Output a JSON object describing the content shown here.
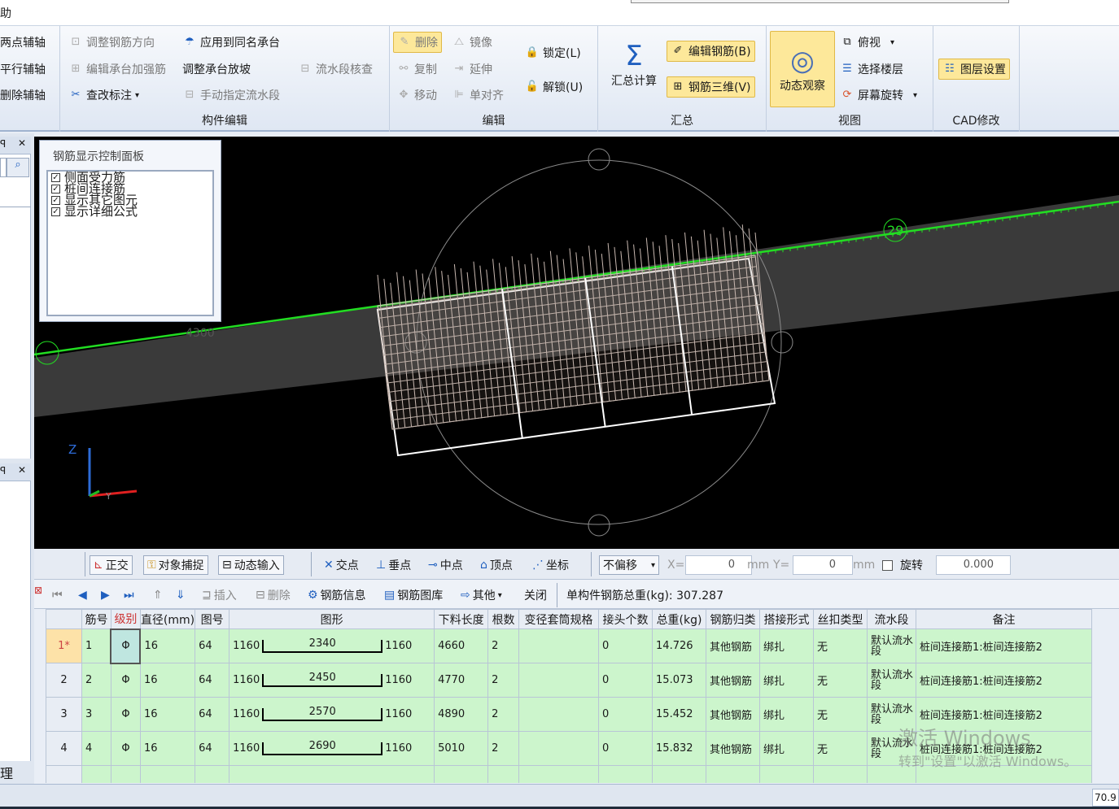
{
  "menu": {
    "help_fragment": "助"
  },
  "ribbon": {
    "axis_group": [
      "两点辅轴",
      "平行辅轴",
      "删除辅轴"
    ],
    "component_edit": {
      "label": "构件编辑",
      "items": [
        "调整钢筋方向",
        "编辑承台加强筋",
        "查改标注",
        "应用到同名承台",
        "调整承台放坡",
        "手动指定流水段",
        "流水段核查"
      ]
    },
    "edit": {
      "label": "编辑",
      "items": [
        "删除",
        "复制",
        "移动",
        "镜像",
        "延伸",
        "单对齐",
        "锁定(L)",
        "解锁(U)"
      ]
    },
    "summary": {
      "label": "汇总",
      "calc": "汇总计算",
      "edit_rebar": "编辑钢筋(B)",
      "rebar_3d": "钢筋三维(V)"
    },
    "view": {
      "label": "视图",
      "dynamic": "动态观察",
      "top_view": "俯视",
      "select_floor": "选择楼层",
      "screen_rotate": "屏幕旋转"
    },
    "cad": {
      "label": "CAD修改",
      "layer": "图层设置"
    }
  },
  "control_panel": {
    "title": "钢筋显示控制面板",
    "items": [
      "侧面受力筋",
      "桩间连接筋",
      "显示其它图元",
      "显示详细公式"
    ]
  },
  "viewport": {
    "labels": [
      "29",
      "4300",
      "Z",
      "Y"
    ]
  },
  "snapbar": {
    "ortho": "正交",
    "object_snap": "对象捕捉",
    "dynamic_input": "动态输入",
    "intersection": "交点",
    "perpendicular": "垂点",
    "midpoint": "中点",
    "vertex": "顶点",
    "coordinate": "坐标",
    "offset": "不偏移",
    "x_label": "X=",
    "x_value": "0",
    "unit1": "mm",
    "y_label": "Y=",
    "y_value": "0",
    "unit2": "mm",
    "rotate": "旋转",
    "rotate_value": "0.000"
  },
  "table_toolbar": {
    "insert": "插入",
    "delete": "删除",
    "rebar_info": "钢筋信息",
    "rebar_library": "钢筋图库",
    "other": "其他",
    "close": "关闭",
    "total_weight": "单构件钢筋总重(kg): 307.287"
  },
  "grid": {
    "columns": [
      "筋号",
      "级别",
      "直径(mm)",
      "图号",
      "图形",
      "下料长度",
      "根数",
      "变径套筒规格",
      "接头个数",
      "总重(kg)",
      "钢筋归类",
      "搭接形式",
      "丝扣类型",
      "流水段",
      "备注"
    ],
    "rows": [
      {
        "hdr": "1*",
        "no": "1",
        "level": "Φ",
        "dia": "16",
        "fig": "64",
        "left": "1160",
        "mid": "2340",
        "right": "1160",
        "length": "4660",
        "count": "2",
        "sleeve": "",
        "joints": "0",
        "weight": "14.726",
        "cat": "其他钢筋",
        "lap": "绑扎",
        "thread": "无",
        "flow": "默认流水段",
        "note": "桩间连接筋1:桩间连接筋2"
      },
      {
        "hdr": "2",
        "no": "2",
        "level": "Φ",
        "dia": "16",
        "fig": "64",
        "left": "1160",
        "mid": "2450",
        "right": "1160",
        "length": "4770",
        "count": "2",
        "sleeve": "",
        "joints": "0",
        "weight": "15.073",
        "cat": "其他钢筋",
        "lap": "绑扎",
        "thread": "无",
        "flow": "默认流水段",
        "note": "桩间连接筋1:桩间连接筋2"
      },
      {
        "hdr": "3",
        "no": "3",
        "level": "Φ",
        "dia": "16",
        "fig": "64",
        "left": "1160",
        "mid": "2570",
        "right": "1160",
        "length": "4890",
        "count": "2",
        "sleeve": "",
        "joints": "0",
        "weight": "15.452",
        "cat": "其他钢筋",
        "lap": "绑扎",
        "thread": "无",
        "flow": "默认流水段",
        "note": "桩间连接筋1:桩间连接筋2"
      },
      {
        "hdr": "4",
        "no": "4",
        "level": "Φ",
        "dia": "16",
        "fig": "64",
        "left": "1160",
        "mid": "2690",
        "right": "1160",
        "length": "5010",
        "count": "2",
        "sleeve": "",
        "joints": "0",
        "weight": "15.832",
        "cat": "其他钢筋",
        "lap": "绑扎",
        "thread": "无",
        "flow": "默认流水段",
        "note": "桩间连接筋1:桩间连接筋2"
      }
    ]
  },
  "left_pane": {
    "bottom_text": "理"
  },
  "status": {
    "zoom": "70.9"
  },
  "watermark": {
    "line1": "激活 Windows",
    "line2": "转到\"设置\"以激活 Windows。"
  },
  "colors": {
    "accent_highlight": "#fde89a",
    "grid_row": "#ccf5cc",
    "ribbon_bg": "#dfe7f3",
    "viewport_bg": "#000000",
    "axis_line": "#22dd22"
  }
}
